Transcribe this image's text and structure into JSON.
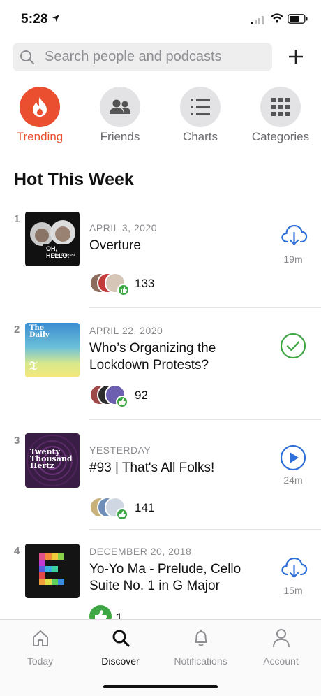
{
  "status_bar": {
    "time": "5:28"
  },
  "search": {
    "placeholder": "Search people and podcasts"
  },
  "categories": [
    {
      "label": "Trending",
      "icon": "flame-icon",
      "active": true
    },
    {
      "label": "Friends",
      "icon": "people-icon",
      "active": false
    },
    {
      "label": "Charts",
      "icon": "list-icon",
      "active": false
    },
    {
      "label": "Categories",
      "icon": "grid-icon",
      "active": false
    }
  ],
  "section": {
    "title": "Hot This Week"
  },
  "episodes": [
    {
      "rank": "1",
      "date": "APRIL 3, 2020",
      "title": "Overture",
      "likes": "133",
      "duration": "19m",
      "action": "download-icon",
      "art_text": "OH, HELLO:",
      "art_sub": "the P'dcast"
    },
    {
      "rank": "2",
      "date": "APRIL 22, 2020",
      "title": "Who’s Organizing the Lockdown Protests?",
      "likes": "92",
      "duration": "",
      "action": "check-icon",
      "art_text": "The Daily"
    },
    {
      "rank": "3",
      "date": "YESTERDAY",
      "title": "#93 | That's All Folks!",
      "likes": "141",
      "duration": "24m",
      "action": "play-icon",
      "art_text": "Twenty Thousand Hertz"
    },
    {
      "rank": "4",
      "date": "DECEMBER 20, 2018",
      "title": "Yo-Yo Ma - Prelude, Cello Suite No. 1 in G Major",
      "likes": "1",
      "duration": "15m",
      "action": "download-icon",
      "art_text": ""
    }
  ],
  "tabs": [
    {
      "label": "Today",
      "icon": "home-icon",
      "active": false
    },
    {
      "label": "Discover",
      "icon": "search-icon",
      "active": true
    },
    {
      "label": "Notifications",
      "icon": "bell-icon",
      "active": false
    },
    {
      "label": "Account",
      "icon": "person-icon",
      "active": false
    }
  ],
  "colors": {
    "accent": "#ea4f2f",
    "action_blue": "#2f6fd9",
    "success_green": "#3fa646"
  }
}
